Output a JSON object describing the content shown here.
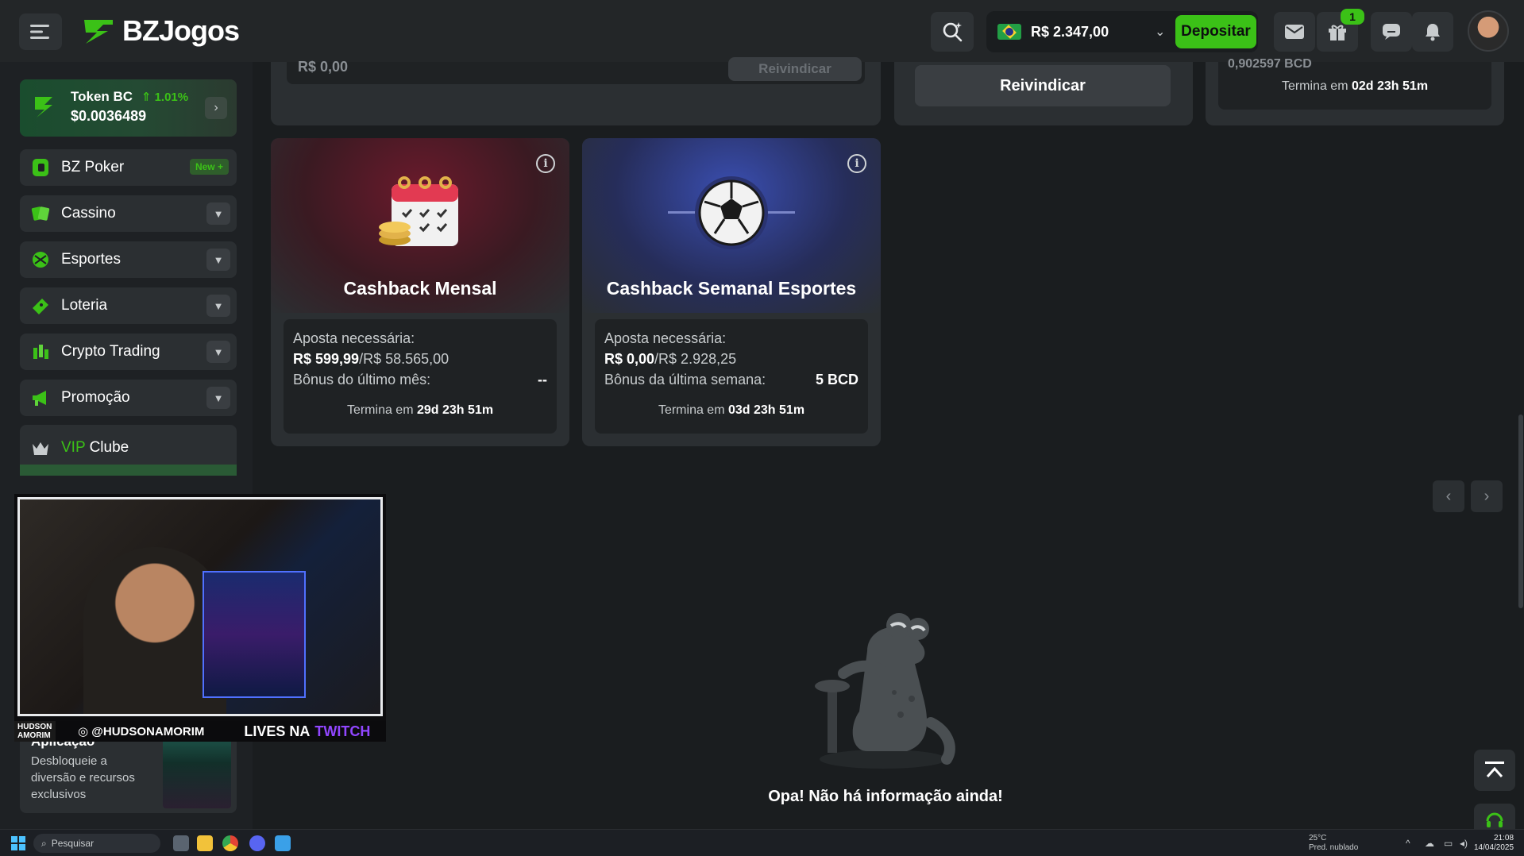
{
  "header": {
    "brand_name": "BZJogos",
    "balance": "R$ 2.347,00",
    "deposit_label": "Depositar",
    "gift_count": "1"
  },
  "sidebar": {
    "token": {
      "name": "Token BC",
      "change": "1.01%",
      "price": "$0.0036489"
    },
    "items": [
      {
        "label": "BZ Poker",
        "badge": "New"
      },
      {
        "label": "Cassino"
      },
      {
        "label": "Esportes"
      },
      {
        "label": "Loteria"
      },
      {
        "label": "Crypto Trading"
      },
      {
        "label": "Promoção"
      }
    ],
    "vip": {
      "prefix": "VIP",
      "suffix": "Clube"
    },
    "app_card": {
      "title": "Aplicação",
      "description": "Desbloqueie a diversão e recursos exclusivos"
    }
  },
  "top_cards": {
    "card1": {
      "amount_partial": "R$ 0,00",
      "claim_label": "Reivindicar"
    },
    "card2": {
      "claim_label": "Reivindicar"
    },
    "card3": {
      "amount_partial": "0,902597 BCD",
      "ends_prefix": "Termina em",
      "ends_value": "02d 23h 51m"
    }
  },
  "cashback_cards": [
    {
      "title": "Cashback Mensal",
      "bet_label": "Aposta necessária:",
      "bet_current": "R$ 599,99",
      "bet_total": "/R$ 58.565,00",
      "bonus_label": "Bônus do último mês:",
      "bonus_value": "--",
      "ends_prefix": "Termina em",
      "ends_value": "29d 23h 51m",
      "info_icon": "info-icon"
    },
    {
      "title": "Cashback Semanal Esportes",
      "bet_label": "Aposta necessária:",
      "bet_current": "R$ 0,00",
      "bet_total": "/R$ 2.928,25",
      "bonus_label": "Bônus da última semana:",
      "bonus_value": "5 BCD",
      "ends_prefix": "Termina em",
      "ends_value": "03d 23h 51m",
      "info_icon": "info-icon"
    }
  ],
  "stream_overlay": {
    "brand": "HUDSON AMORIM",
    "instagram": "@HUDSONAMORIM",
    "lives_label": "LIVES NA",
    "platform": "TWITCH"
  },
  "empty_state": {
    "message": "Opa! Não há informação ainda!"
  },
  "taskbar": {
    "search_placeholder": "Pesquisar",
    "weather_temp": "25°C",
    "weather_desc": "Pred. nublado",
    "time": "21:08",
    "date": "14/04/2025"
  },
  "colors": {
    "accent": "#3bc117",
    "background": "#1a1d1f",
    "card": "#2b2f32",
    "twitch": "#9146ff"
  }
}
